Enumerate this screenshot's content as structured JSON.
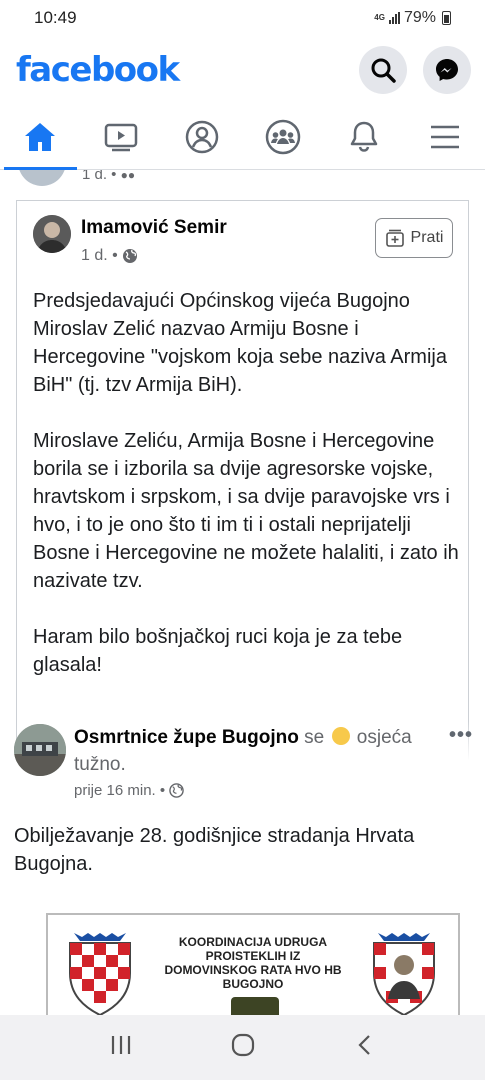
{
  "status_bar": {
    "time": "10:49",
    "network": "4G",
    "battery": "79%"
  },
  "header": {
    "logo": "facebook",
    "icons": [
      "search-icon",
      "messenger-icon"
    ]
  },
  "nav_tabs": [
    {
      "name": "home",
      "icon": "home-icon",
      "active": true
    },
    {
      "name": "watch",
      "icon": "video-icon",
      "active": false
    },
    {
      "name": "profile",
      "icon": "profile-icon",
      "active": false
    },
    {
      "name": "groups",
      "icon": "groups-icon",
      "active": false
    },
    {
      "name": "notifications",
      "icon": "bell-icon",
      "active": false
    },
    {
      "name": "menu",
      "icon": "hamburger-icon",
      "active": false
    }
  ],
  "previous_post": {
    "meta": "1 d. • "
  },
  "shared_post": {
    "author": "Imamović Semir",
    "meta": "1 d. •",
    "follow_label": "Prati",
    "paragraphs": [
      "Predsjedavajući Općinskog vijeća Bugojno Miroslav Zelić nazvao Armiju Bosne i Hercegovine \"vojskom koja sebe naziva Armija BiH\" (tj. tzv Armija BiH).",
      "Miroslave Zeliću, Armija Bosne i Hercegovine borila se i izborila sa dvije agresorske vojske, hravtskom i srpskom, i sa dvije paravojske vrs i hvo, i to je ono što ti im ti i ostali neprijatelji Bosne i Hercegovine ne možete halaliti, i zato ih nazivate tzv.",
      "Haram bilo bošnjačkoj ruci koja je za tebe glasala!"
    ]
  },
  "post2": {
    "page_name": "Osmrtnice župe Bugojno",
    "feeling_prefix": "se",
    "feeling_suffix": "osjeća tužno.",
    "meta": "prije 16 min. •",
    "text": "Obilježavanje 28. godišnjice stradanja Hrvata Bugojna.",
    "image_text": "KOORDINACIJA UDRUGA PROISTEKLIH IZ DOMOVINSKOG RATA HVO HB BUGOJNO"
  },
  "system_nav": [
    "recent-apps-icon",
    "home-circle-icon",
    "back-icon"
  ],
  "colors": {
    "brand": "#1877f2",
    "secondary_text": "#65676b",
    "icon_bg": "#e4e6eb"
  }
}
